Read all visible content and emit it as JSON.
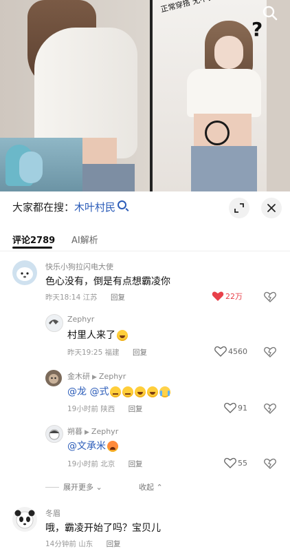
{
  "video": {
    "overlay_text": "正常穿搭 无不良",
    "search_icon": "search-icon"
  },
  "header": {
    "search_prefix": "大家都在搜：",
    "search_term": "木叶村民",
    "expand_icon": "expand-icon",
    "close_icon": "close-icon"
  },
  "tabs": [
    {
      "label": "评论2789",
      "active": true
    },
    {
      "label": "AI解析",
      "active": false
    }
  ],
  "comments": [
    {
      "nickname": "快乐小狗拉闪电大使",
      "text": "色心没有，倒是有点想霸凌你",
      "time": "昨天18:14",
      "location": "江苏",
      "reply_label": "回复",
      "likes": "22万",
      "liked": true
    },
    {
      "nickname": "Zephyr",
      "text": "村里人来了",
      "time": "昨天19:25",
      "location": "福建",
      "reply_label": "回复",
      "likes": "4560",
      "liked": false
    },
    {
      "nickname": "金木研",
      "reply_to": "Zephyr",
      "text_mention": "@龙 @式",
      "time": "19小时前",
      "location": "陕西",
      "reply_label": "回复",
      "likes": "91",
      "liked": false
    },
    {
      "nickname": "朔暮",
      "reply_to": "Zephyr",
      "text_mention": "@文承米",
      "time": "19小时前",
      "location": "北京",
      "reply_label": "回复",
      "likes": "55",
      "liked": false
    },
    {
      "nickname": "冬眉",
      "text": "哦，霸凌开始了吗？宝贝儿",
      "time": "14分钟前",
      "location": "山东",
      "reply_label": "回复"
    }
  ],
  "thread_controls": {
    "expand_more": "展开更多",
    "collapse": "收起"
  },
  "colors": {
    "accent_blue": "#2a5bb8",
    "like_red": "#e8404a"
  }
}
